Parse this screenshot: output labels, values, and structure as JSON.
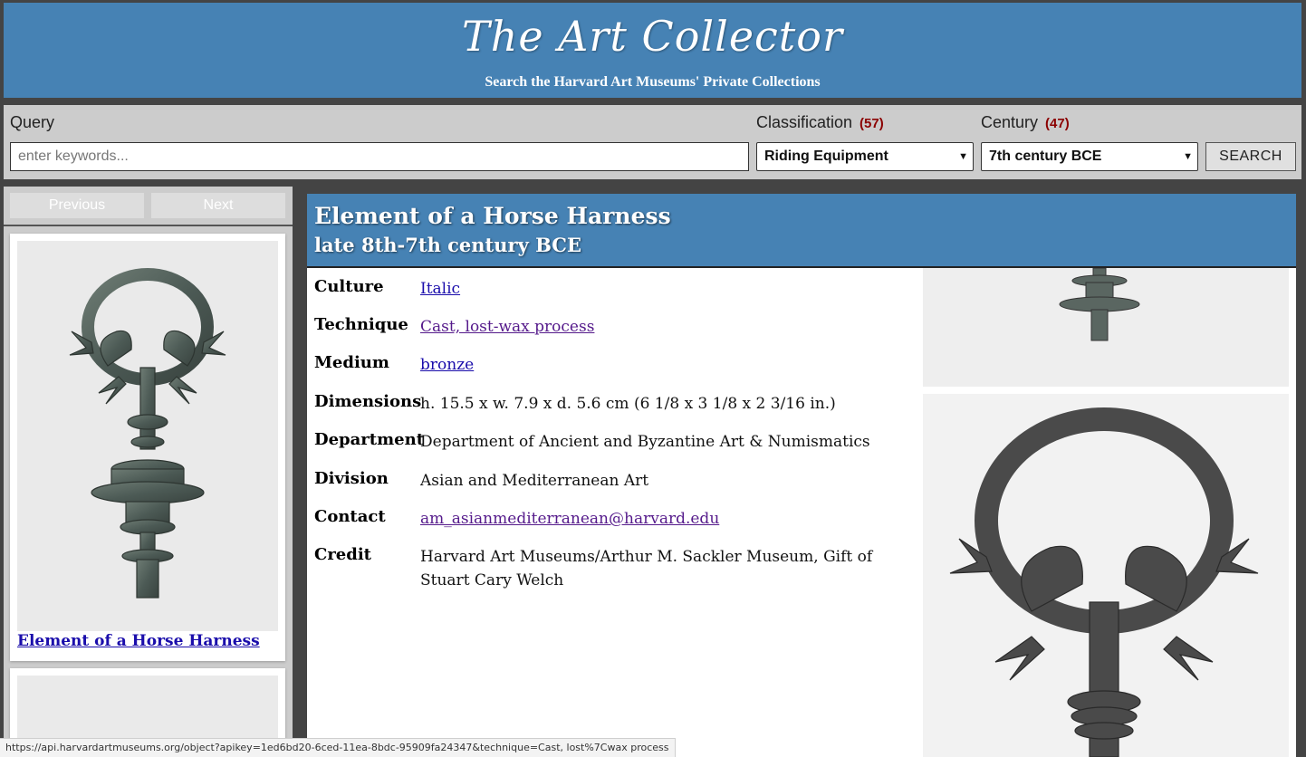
{
  "header": {
    "title": "The Art Collector",
    "subtitle": "Search the Harvard Art Museums' Private Collections"
  },
  "search": {
    "query_label": "Query",
    "query_placeholder": "enter keywords...",
    "classification_label": "Classification",
    "classification_count": "(57)",
    "classification_value": "Riding Equipment",
    "century_label": "Century",
    "century_count": "(47)",
    "century_value": "7th century BCE",
    "button_label": "SEARCH"
  },
  "sidebar": {
    "previous_label": "Previous",
    "next_label": "Next",
    "results": [
      {
        "title": "Element of a Horse Harness"
      }
    ]
  },
  "detail": {
    "title": "Element of a Horse Harness",
    "date": "late 8th-7th century BCE",
    "facts": [
      {
        "label": "Culture",
        "value": "Italic"
      },
      {
        "label": "Technique",
        "value": "Cast, lost-wax process"
      },
      {
        "label": "Medium",
        "value": "bronze"
      },
      {
        "label": "Dimensions",
        "value": "h. 15.5 x w. 7.9 x d. 5.6 cm (6 1/8 x 3 1/8 x 2 3/16 in.)"
      },
      {
        "label": "Department",
        "value": "Department of Ancient and Byzantine Art & Numismatics"
      },
      {
        "label": "Division",
        "value": "Asian and Mediterranean Art"
      },
      {
        "label": "Contact",
        "value": "am_asianmediterranean@harvard.edu"
      },
      {
        "label": "Credit",
        "value": "Harvard Art Museums/Arthur M. Sackler Museum, Gift of Stuart Cary Welch"
      }
    ]
  },
  "status_url": "https://api.harvardartmuseums.org/object?apikey=1ed6bd20-6ced-11ea-8bdc-95909fa24347&technique=Cast, lost%7Cwax process",
  "colors": {
    "brand": "#4682b4",
    "link": "#1a0dab",
    "visited_link": "#551a8b",
    "count": "#8b0000"
  }
}
